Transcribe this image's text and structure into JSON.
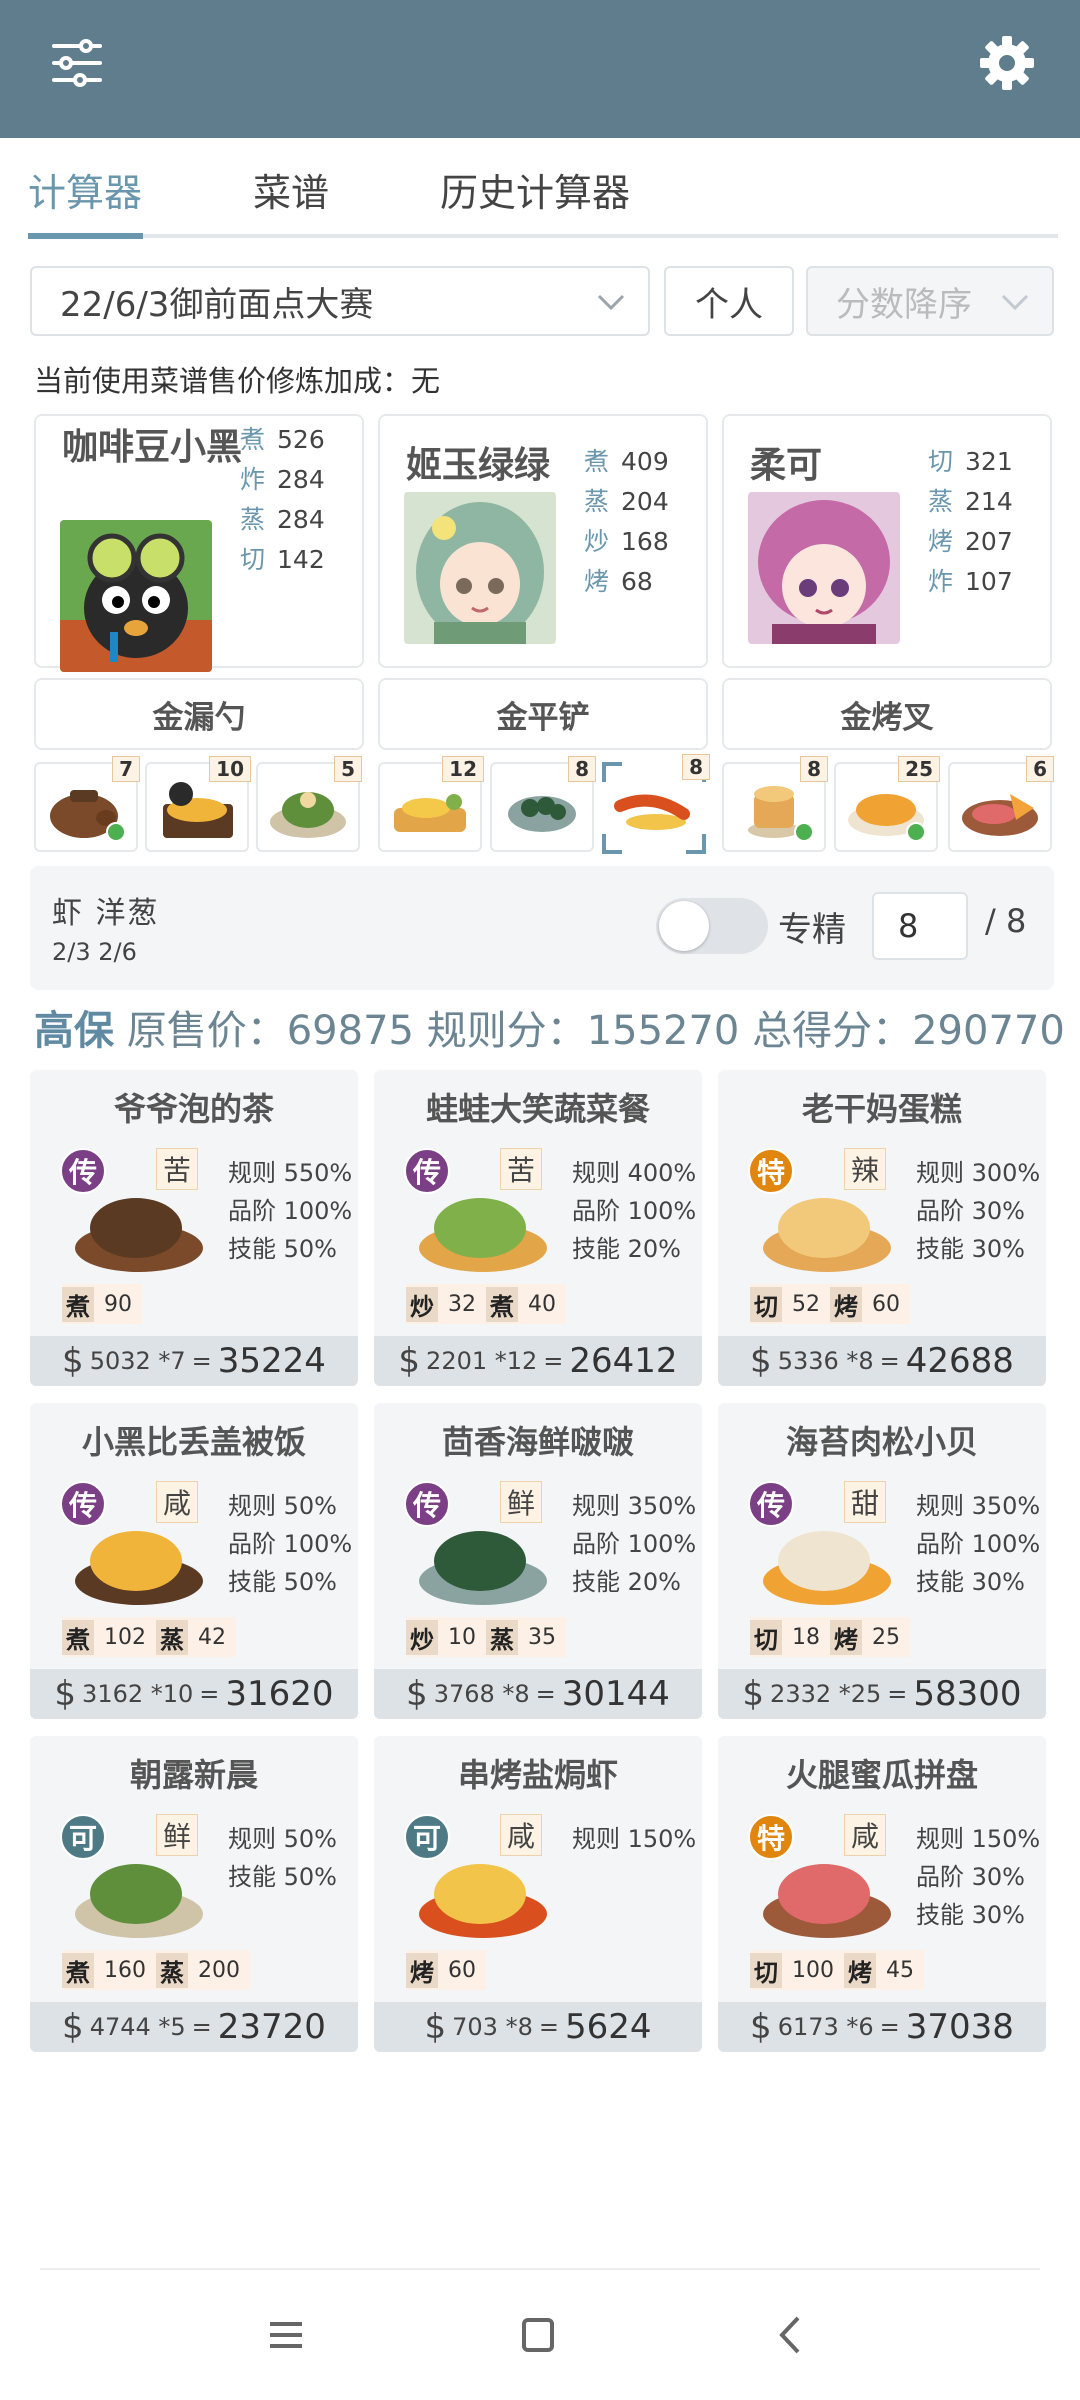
{
  "topbar": {
    "menu_icon": "sliders-icon",
    "settings_icon": "gear-icon",
    "bg": "#5f7d8c"
  },
  "tabs": [
    {
      "label": "计算器",
      "active": true
    },
    {
      "label": "菜谱",
      "active": false
    },
    {
      "label": "历史计算器",
      "active": false
    }
  ],
  "filters": {
    "contest": "22/6/3御前面点大赛",
    "mode": "个人",
    "sort": "分数降序"
  },
  "bonus_text": "当前使用菜谱售价修炼加成：无",
  "chefs": [
    {
      "name": "咖啡豆小黑",
      "skills": [
        {
          "k": "煮",
          "v": "526"
        },
        {
          "k": "炸",
          "v": "284"
        },
        {
          "k": "蒸",
          "v": "284"
        },
        {
          "k": "切",
          "v": "142"
        }
      ],
      "equip": "金漏勺"
    },
    {
      "name": "姬玉绿绿",
      "skills": [
        {
          "k": "煮",
          "v": "409"
        },
        {
          "k": "蒸",
          "v": "204"
        },
        {
          "k": "炒",
          "v": "168"
        },
        {
          "k": "烤",
          "v": "68"
        }
      ],
      "equip": "金平铲"
    },
    {
      "name": "柔可",
      "skills": [
        {
          "k": "切",
          "v": "321"
        },
        {
          "k": "蒸",
          "v": "214"
        },
        {
          "k": "烤",
          "v": "207"
        },
        {
          "k": "炸",
          "v": "107"
        }
      ],
      "equip": "金烤叉"
    }
  ],
  "dish_thumbs": [
    {
      "qty": "7",
      "checked": true
    },
    {
      "qty": "10",
      "checked": false
    },
    {
      "qty": "5",
      "checked": false
    },
    {
      "qty": "12",
      "checked": false
    },
    {
      "qty": "8",
      "checked": false
    },
    {
      "qty": "8",
      "checked": false,
      "selected": true
    },
    {
      "qty": "8",
      "checked": true
    },
    {
      "qty": "25",
      "checked": true
    },
    {
      "qty": "6",
      "checked": false
    }
  ],
  "panel": {
    "ingredients": "虾 洋葱",
    "ingredient_counts": "2/3 2/6",
    "specialty_label": "专精",
    "specialty_on": false,
    "count_value": "8",
    "count_total": "/ 8"
  },
  "score": {
    "level": "高保",
    "orig_label": "原售价：",
    "orig_value": "69875",
    "rule_label": "规则分：",
    "rule_value": "155270",
    "total_label": "总得分：",
    "total_value": "290770"
  },
  "recipes": [
    {
      "name": "爷爷泡的茶",
      "grade": "传",
      "taste": "苦",
      "rules": [
        "规则 550%",
        "品阶 100%",
        "技能 50%"
      ],
      "needs": [
        {
          "k": "煮",
          "v": "90"
        }
      ],
      "price": "5032 *7",
      "result": "35224"
    },
    {
      "name": "蛙蛙大笑蔬菜餐",
      "grade": "传",
      "taste": "苦",
      "rules": [
        "规则 400%",
        "品阶 100%",
        "技能 20%"
      ],
      "needs": [
        {
          "k": "炒",
          "v": "32"
        },
        {
          "k": "煮",
          "v": "40"
        }
      ],
      "price": "2201 *12",
      "result": "26412"
    },
    {
      "name": "老干妈蛋糕",
      "grade": "特",
      "taste": "辣",
      "rules": [
        "规则 300%",
        "品阶 30%",
        "技能 30%"
      ],
      "needs": [
        {
          "k": "切",
          "v": "52"
        },
        {
          "k": "烤",
          "v": "60"
        }
      ],
      "price": "5336 *8",
      "result": "42688"
    },
    {
      "name": "小黑比丢盖被饭",
      "grade": "传",
      "taste": "咸",
      "rules": [
        "规则 50%",
        "品阶 100%",
        "技能 50%"
      ],
      "needs": [
        {
          "k": "煮",
          "v": "102"
        },
        {
          "k": "蒸",
          "v": "42"
        }
      ],
      "price": "3162 *10",
      "result": "31620"
    },
    {
      "name": "茴香海鲜啵啵",
      "grade": "传",
      "taste": "鲜",
      "rules": [
        "规则 350%",
        "品阶 100%",
        "技能 20%"
      ],
      "needs": [
        {
          "k": "炒",
          "v": "10"
        },
        {
          "k": "蒸",
          "v": "35"
        }
      ],
      "price": "3768 *8",
      "result": "30144"
    },
    {
      "name": "海苔肉松小贝",
      "grade": "传",
      "taste": "甜",
      "rules": [
        "规则 350%",
        "品阶 100%",
        "技能 30%"
      ],
      "needs": [
        {
          "k": "切",
          "v": "18"
        },
        {
          "k": "烤",
          "v": "25"
        }
      ],
      "price": "2332 *25",
      "result": "58300"
    },
    {
      "name": "朝露新晨",
      "grade": "可",
      "taste": "鲜",
      "rules": [
        "规则 50%",
        "技能 50%"
      ],
      "needs": [
        {
          "k": "煮",
          "v": "160"
        },
        {
          "k": "蒸",
          "v": "200"
        }
      ],
      "price": "4744 *5",
      "result": "23720"
    },
    {
      "name": "串烤盐焗虾",
      "grade": "可",
      "taste": "咸",
      "rules": [
        "规则 150%"
      ],
      "needs": [
        {
          "k": "烤",
          "v": "60"
        }
      ],
      "price": "703 *8",
      "result": "5624"
    },
    {
      "name": "火腿蜜瓜拼盘",
      "grade": "特",
      "taste": "咸",
      "rules": [
        "规则 150%",
        "品阶 30%",
        "技能 30%"
      ],
      "needs": [
        {
          "k": "切",
          "v": "100"
        },
        {
          "k": "烤",
          "v": "45"
        }
      ],
      "price": "6173 *6",
      "result": "37038"
    }
  ],
  "currency_symbol": "$",
  "nav": {
    "menu_icon": "recents-icon",
    "home_icon": "home-icon",
    "back_icon": "back-icon"
  }
}
